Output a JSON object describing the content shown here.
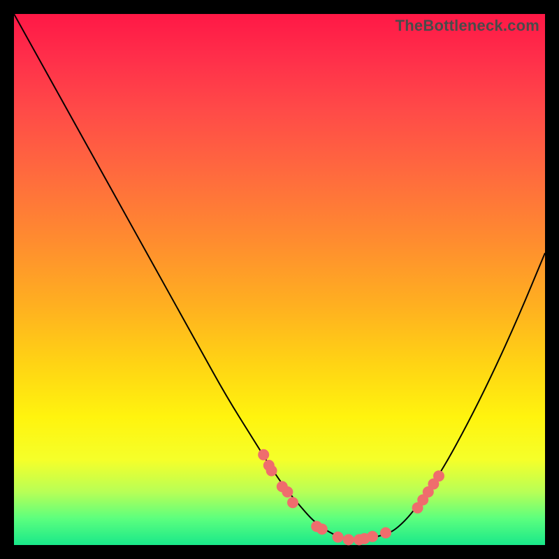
{
  "watermark": "TheBottleneck.com",
  "colors": {
    "curve": "#000000",
    "dots": "#ef6d6d",
    "dots_stroke": "#c94e4e"
  },
  "chart_data": {
    "type": "line",
    "title": "",
    "xlabel": "",
    "ylabel": "",
    "xlim": [
      0,
      100
    ],
    "ylim": [
      0,
      100
    ],
    "grid": false,
    "legend": false,
    "series": [
      {
        "name": "bottleneck-curve",
        "x": [
          0,
          5,
          10,
          15,
          20,
          25,
          30,
          35,
          40,
          45,
          50,
          55,
          57,
          60,
          63,
          66,
          70,
          72,
          75,
          80,
          85,
          90,
          95,
          100
        ],
        "y": [
          100,
          91,
          82,
          73,
          64,
          55,
          46,
          37,
          28,
          20,
          12,
          6,
          4,
          2,
          1,
          1,
          2,
          3,
          6,
          13,
          22,
          32,
          43,
          55
        ]
      }
    ],
    "markers": [
      {
        "x": 47,
        "y": 17
      },
      {
        "x": 48,
        "y": 15
      },
      {
        "x": 48.5,
        "y": 14
      },
      {
        "x": 50.5,
        "y": 11
      },
      {
        "x": 51.5,
        "y": 10
      },
      {
        "x": 52.5,
        "y": 8
      },
      {
        "x": 57,
        "y": 3.5
      },
      {
        "x": 58,
        "y": 3
      },
      {
        "x": 61,
        "y": 1.5
      },
      {
        "x": 63,
        "y": 1
      },
      {
        "x": 65,
        "y": 1
      },
      {
        "x": 66,
        "y": 1.2
      },
      {
        "x": 67.5,
        "y": 1.6
      },
      {
        "x": 70,
        "y": 2.3
      },
      {
        "x": 76,
        "y": 7
      },
      {
        "x": 77,
        "y": 8.5
      },
      {
        "x": 78,
        "y": 10
      },
      {
        "x": 79,
        "y": 11.5
      },
      {
        "x": 80,
        "y": 13
      }
    ]
  }
}
